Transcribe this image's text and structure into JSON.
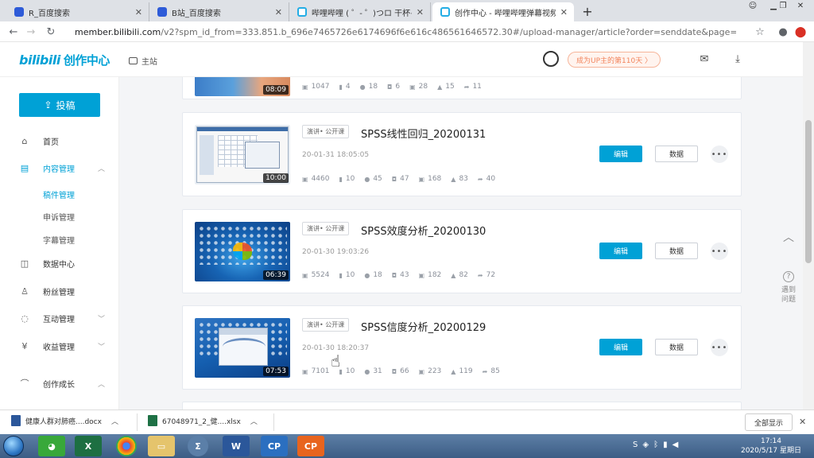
{
  "browser": {
    "tabs": [
      {
        "title": "R_百度搜索",
        "icon": "baidu-icon"
      },
      {
        "title": "B站_百度搜索",
        "icon": "baidu-icon"
      },
      {
        "title": "哔哩哔哩 ( ゜- ゜)つロ 干杯~-bilibili",
        "icon": "bilibili-icon"
      },
      {
        "title": "创作中心 - 哔哩哔哩弹幕视频网",
        "icon": "bilibili-icon",
        "active": true
      }
    ],
    "url_host": "member.bilibili.com",
    "url_path": "/v2?spm_id_from=333.851.b_696e7465726e6174696f6e616c486561646572.30#/upload-manager/article?order=senddate&page=5"
  },
  "header": {
    "logo_text": "bilibili",
    "logo_sub": "创作中心",
    "home_link": "主站",
    "up_badge": "成为UP主的第110天 〉"
  },
  "sidebar": {
    "upload_label": "投稿",
    "items": [
      {
        "label": "首页",
        "icon": "home-icon"
      },
      {
        "label": "内容管理",
        "icon": "content-icon",
        "active": true
      },
      {
        "label": "数据中心",
        "icon": "data-icon"
      },
      {
        "label": "粉丝管理",
        "icon": "fans-icon"
      },
      {
        "label": "互动管理",
        "icon": "interaction-icon"
      },
      {
        "label": "收益管理",
        "icon": "income-icon"
      },
      {
        "label": "创作成长",
        "icon": "growth-icon"
      }
    ],
    "subitems": [
      "稿件管理",
      "申诉管理",
      "字幕管理"
    ]
  },
  "videos": [
    {
      "duration": "08:09",
      "stats": {
        "views": "1047",
        "danmaku": "4",
        "comments": "18",
        "coins": "6",
        "favorites": "28",
        "likes": "15",
        "shares": "11"
      }
    },
    {
      "tag": "演讲• 公开课",
      "title": "SPSS线性回归_20200131",
      "date": "20-01-31 18:05:05",
      "duration": "10:00",
      "stats": {
        "views": "4460",
        "danmaku": "10",
        "comments": "45",
        "coins": "47",
        "favorites": "168",
        "likes": "83",
        "shares": "40"
      }
    },
    {
      "tag": "演讲• 公开课",
      "title": "SPSS效度分析_20200130",
      "date": "20-01-30 19:03:26",
      "duration": "06:39",
      "stats": {
        "views": "5524",
        "danmaku": "10",
        "comments": "18",
        "coins": "43",
        "favorites": "182",
        "likes": "82",
        "shares": "72"
      }
    },
    {
      "tag": "演讲• 公开课",
      "title": "SPSS信度分析_20200129",
      "date": "20-01-30 18:20:37",
      "duration": "07:53",
      "stats": {
        "views": "7101",
        "danmaku": "10",
        "comments": "31",
        "coins": "66",
        "favorites": "223",
        "likes": "119",
        "shares": "85"
      }
    }
  ],
  "actions": {
    "edit": "编辑",
    "data": "数据"
  },
  "feedback_label_1": "遇到",
  "feedback_label_2": "问题",
  "downloads": [
    {
      "name": "健康人群对肺癌....docx"
    },
    {
      "name": "67048971_2_健....xlsx"
    }
  ],
  "show_all": "全部显示",
  "clock": {
    "time": "17:14",
    "date": "2020/5/17 星期日"
  }
}
